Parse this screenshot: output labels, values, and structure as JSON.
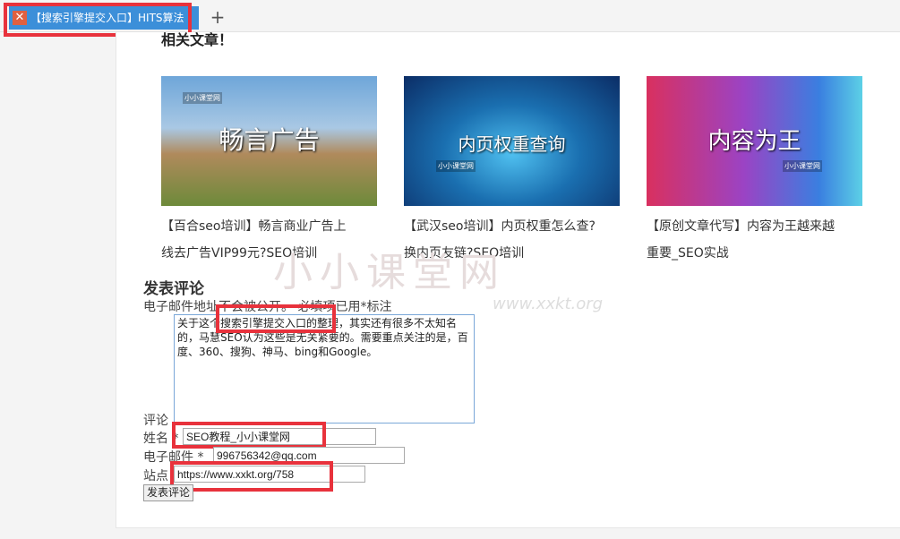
{
  "browser": {
    "tab_title": "【搜索引擎提交入口】HITS算法",
    "new_tab": "+"
  },
  "related": {
    "heading": "相关文章！",
    "cards": [
      {
        "image_text": "畅言广告",
        "logo": "小小课堂网",
        "title_line1": "【百合seo培训】畅言商业广告上",
        "title_line2": "线去广告VIP99元?SEO培训"
      },
      {
        "image_text": "内页权重查询",
        "logo": "小小课堂网",
        "title_line1": "【武汉seo培训】内页权重怎么查?",
        "title_line2": "换内页友链?SEO培训"
      },
      {
        "image_text": "内容为王",
        "logo": "小小课堂网",
        "title_line1": "【原创文章代写】内容为王越来越",
        "title_line2": "重要_SEO实战"
      }
    ]
  },
  "watermark": {
    "name": "小小课堂网",
    "url": "www.xxkt.org"
  },
  "comment_form": {
    "heading": "发表评论",
    "notes": "电子邮件地址不会被公开。 必填项已用*标注",
    "comment_text": "关于这个搜索引擎提交入口的整理，其实还有很多不太知名的，马慧SEO认为这些是无关紧要的。需要重点关注的是，百度、360、搜狗、神马、bing和Google。",
    "comment_label": "评论",
    "name_label": "姓名 *",
    "name_value": "SEO教程_小小课堂网",
    "email_label": "电子邮件 *",
    "email_value": "996756342@qq.com",
    "site_label": "站点",
    "site_value": "https://www.xxkt.org/758",
    "submit_label": "发表评论"
  },
  "colors": {
    "tab_active": "#3c8fd9",
    "highlight": "#e8323c",
    "textarea_border": "#7aa7d8"
  }
}
